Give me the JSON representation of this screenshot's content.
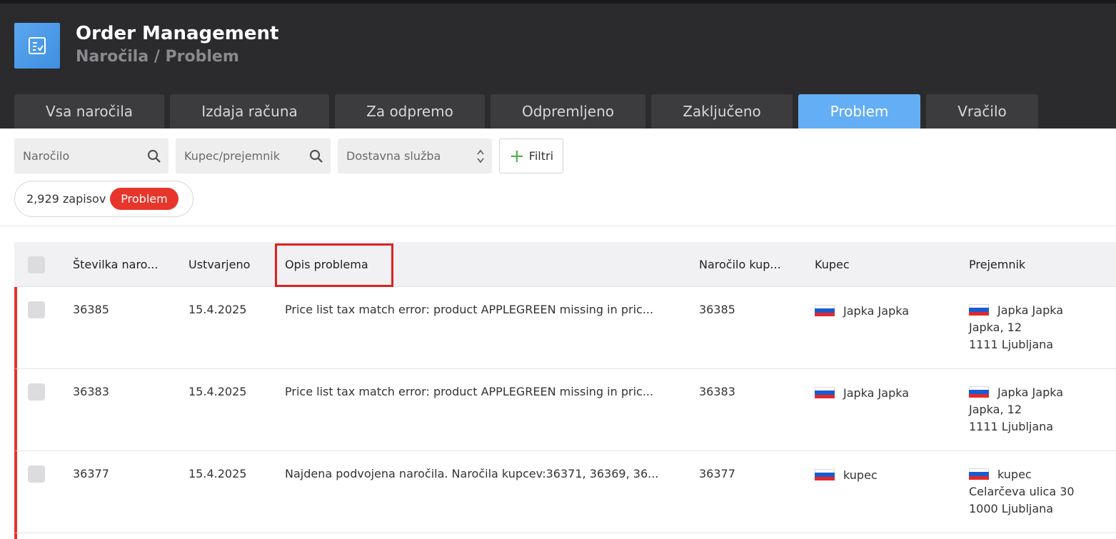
{
  "app": {
    "title": "Order Management",
    "breadcrumb": "Naročila / Problem",
    "icon": "checklist-icon",
    "accent": "#63aef5"
  },
  "tabs": [
    {
      "label": "Vsa naročila",
      "active": false
    },
    {
      "label": "Izdaja računa",
      "active": false
    },
    {
      "label": "Za odpremo",
      "active": false
    },
    {
      "label": "Odpremljeno",
      "active": false
    },
    {
      "label": "Zaključeno",
      "active": false
    },
    {
      "label": "Problem",
      "active": true
    },
    {
      "label": "Vračilo",
      "active": false
    }
  ],
  "filters": {
    "order_placeholder": "Naročilo",
    "customer_placeholder": "Kupec/prejemnik",
    "shipping_placeholder": "Dostavna služba",
    "filter_button": "Filtri"
  },
  "summary": {
    "count_text": "2,929 zapisov",
    "status_badge": "Problem",
    "badge_color": "#e7352b"
  },
  "table": {
    "columns": [
      "Številka naro...",
      "Ustvarjeno",
      "Opis problema",
      "Naročilo kup...",
      "Kupec",
      "Prejemnik"
    ],
    "rows": [
      {
        "number": "36385",
        "created": "15.4.2025",
        "problem": "Price list tax match error: product APPLEGREEN missing in pric...",
        "customer_order": "36385",
        "customer": "Japka Japka",
        "recipient_name": "Japka Japka",
        "recipient_street": "Japka, 12",
        "recipient_city": "1111 Ljubljana"
      },
      {
        "number": "36383",
        "created": "15.4.2025",
        "problem": "Price list tax match error: product APPLEGREEN missing in pric...",
        "customer_order": "36383",
        "customer": "Japka Japka",
        "recipient_name": "Japka Japka",
        "recipient_street": "Japka, 12",
        "recipient_city": "1111 Ljubljana"
      },
      {
        "number": "36377",
        "created": "15.4.2025",
        "problem": "Najdena podvojena naročila. Naročila kupcev:36371, 36369, 36...",
        "customer_order": "36377",
        "customer": "kupec",
        "recipient_name": "kupec",
        "recipient_street": "Celarčeva ulica 30",
        "recipient_city": "1000 Ljubljana"
      }
    ]
  }
}
